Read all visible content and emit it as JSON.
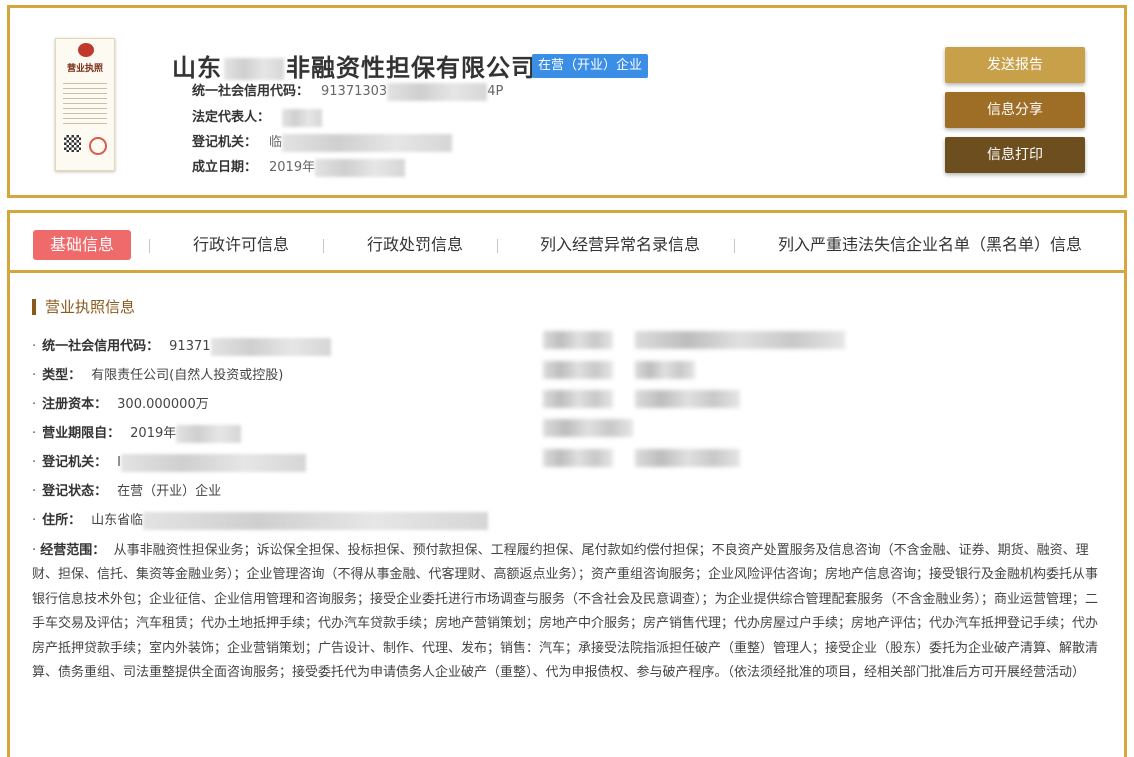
{
  "header": {
    "license_title": "营业执照",
    "company_name_prefix": "山东",
    "company_name_suffix": "非融资性担保有限公司",
    "status_tag": "在营（开业）企业",
    "credit_code_label": "统一社会信用代码：",
    "credit_code_value_start": "91371303",
    "credit_code_value_end": "4P",
    "legal_rep_label": "法定代表人：",
    "reg_authority_label": "登记机关：",
    "reg_authority_value_start": "临",
    "established_label": "成立日期：",
    "established_value_start": "2019年"
  },
  "buttons": {
    "send": "发送报告",
    "share": "信息分享",
    "print": "信息打印"
  },
  "tabs": [
    {
      "label": "基础信息",
      "active": true
    },
    {
      "label": "行政许可信息"
    },
    {
      "label": "行政处罚信息"
    },
    {
      "label": "列入经营异常名录信息"
    },
    {
      "label": "列入严重违法失信企业名单（黑名单）信息"
    }
  ],
  "section": {
    "title": "营业执照信息"
  },
  "fields": {
    "credit_code": {
      "label": "统一社会信用代码：",
      "value": "91371"
    },
    "type": {
      "label": "类型：",
      "value": "有限责任公司(自然人投资或控股)"
    },
    "capital": {
      "label": "注册资本：",
      "value": "300.000000万"
    },
    "term": {
      "label": "营业期限自：",
      "value": "2019年"
    },
    "authority": {
      "label": "登记机关：",
      "value": "I"
    },
    "status": {
      "label": "登记状态：",
      "value": "在营（开业）企业"
    },
    "address": {
      "label": "住所：",
      "value": "山东省临"
    },
    "scope": {
      "label": "经营范围：",
      "value": "从事非融资性担保业务；诉讼保全担保、投标担保、预付款担保、工程履约担保、尾付款如约偿付担保；不良资产处置服务及信息咨询（不含金融、证券、期货、融资、理财、担保、信托、集资等金融业务）；企业管理咨询（不得从事金融、代客理财、高额返点业务）；资产重组咨询服务；企业风险评估咨询；房地产信息咨询；接受银行及金融机构委托从事银行信息技术外包；企业征信、企业信用管理和咨询服务；接受企业委托进行市场调查与服务（不含社会及民意调查）；为企业提供综合管理配套服务（不含金融业务）；商业运营管理；二手车交易及评估；汽车租赁；代办土地抵押手续；代办汽车贷款手续；房地产营销策划；房地产中介服务；房产销售代理；代办房屋过户手续；房地产评估；代办汽车抵押登记手续；代办房产抵押贷款手续；室内外装饰；企业营销策划；广告设计、制作、代理、发布；销售：汽车；承接受法院指派担任破产（重整）管理人；接受企业（股东）委托为企业破产清算、解散清算、债务重组、司法重整提供全面咨询服务；接受委托代为申请债务人企业破产（重整）、代为申报债权、参与破产程序。（依法须经批准的项目，经相关部门批准后方可开展经营活动）"
    }
  }
}
